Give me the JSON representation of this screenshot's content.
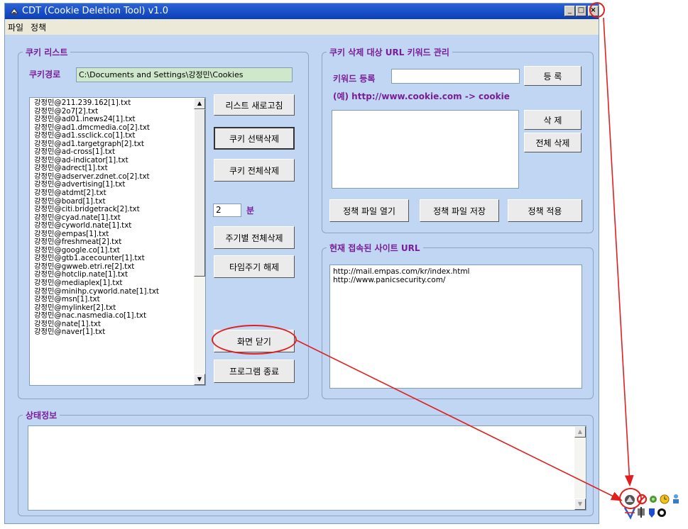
{
  "window": {
    "title": "CDT (Cookie Deletion Tool) v1.0",
    "min_btn": "_",
    "max_btn": "□",
    "close_btn": "×"
  },
  "menu": [
    "파일",
    "정책"
  ],
  "cookie_list": {
    "group_title": "쿠키 리스트",
    "path_label": "쿠키경로",
    "path_value": "C:\\Documents and Settings\\강정민\\Cookies",
    "items": [
      "강정민@211.239.162[1].txt",
      "강정민@2o7[2].txt",
      "강정민@ad01.inews24[1].txt",
      "강정민@ad1.dmcmedia.co[2].txt",
      "강정민@ad1.ssclick.co[1].txt",
      "강정민@ad1.targetgraph[2].txt",
      "강정민@ad-cross[1].txt",
      "강정민@ad-indicator[1].txt",
      "강정민@adrect[1].txt",
      "강정민@adserver.zdnet.co[2].txt",
      "강정민@advertising[1].txt",
      "강정민@atdmt[2].txt",
      "강정민@board[1].txt",
      "강정민@citi.bridgetrack[2].txt",
      "강정민@cyad.nate[1].txt",
      "강정민@cyworld.nate[1].txt",
      "강정민@empas[1].txt",
      "강정민@freshmeat[2].txt",
      "강정민@google.co[1].txt",
      "강정민@gtb1.acecounter[1].txt",
      "강정민@gwweb.etri.re[2].txt",
      "강정민@hotclip.nate[1].txt",
      "강정민@mediaplex[1].txt",
      "강정민@minihp.cyworld.nate[1].txt",
      "강정민@msn[1].txt",
      "강정민@mylinker[2].txt",
      "강정민@nac.nasmedia.co[1].txt",
      "강정민@nate[1].txt",
      "강정민@naver[1].txt"
    ],
    "buttons": {
      "refresh": "리스트 새로고침",
      "delete_selected": "쿠키 선택삭제",
      "delete_all": "쿠키 전체삭제",
      "interval_value": "2",
      "interval_unit": "분",
      "periodic_delete": "주기별 전체삭제",
      "cancel_timer": "타임주기 해제",
      "close_screen": "화면 닫기",
      "exit_program": "프로그램 종료"
    }
  },
  "url_keywords": {
    "group_title": "쿠키 삭제 대상 URL 키워드 관리",
    "keyword_label": "키워드 등록",
    "keyword_value": "",
    "register": "등 록",
    "example": "(예) http://www.cookie.com -> cookie",
    "delete": "삭 제",
    "delete_all": "전체 삭제",
    "open_policy": "정책 파일 열기",
    "save_policy": "정책 파일 저장",
    "apply_policy": "정책 적용"
  },
  "current_sites": {
    "group_title": "현재 접속된 사이트 URL",
    "urls": [
      "http://mail.empas.com/kr/index.html",
      "http://www.panicsecurity.com/"
    ]
  },
  "status": {
    "group_title": "상태정보"
  },
  "colors": {
    "window_bg": "#c1d6f2",
    "label_purple": "#7a1d9a",
    "annotation_red": "#e02020"
  },
  "tray_icons": [
    "cdt-icon",
    "block-icon",
    "green-icon",
    "clock-icon",
    "user-icon",
    "network-icon",
    "tool-icon",
    "shield-icon",
    "info-icon"
  ]
}
